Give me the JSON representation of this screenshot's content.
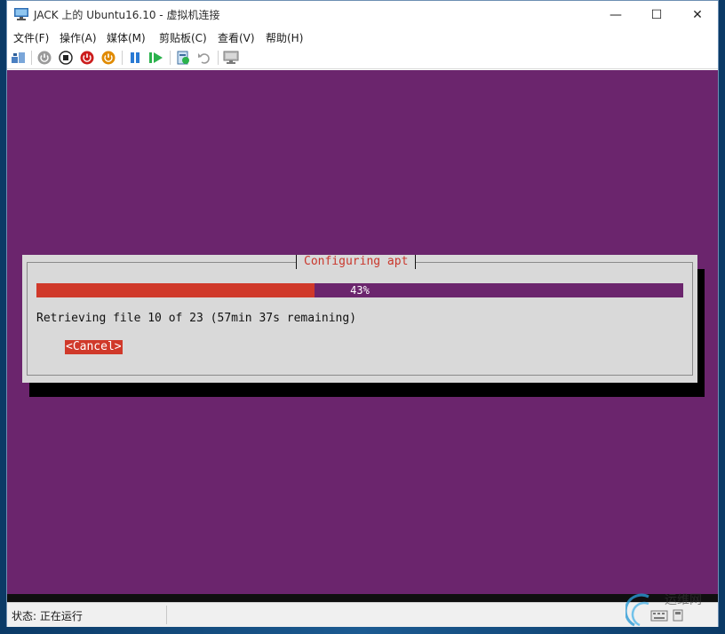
{
  "window": {
    "title": "JACK 上的 Ubuntu16.10 - 虚拟机连接",
    "min_glyph": "—",
    "max_glyph": "☐",
    "close_glyph": "✕"
  },
  "menu": {
    "items": [
      "文件(F)",
      "操作(A)",
      "媒体(M)",
      "剪贴板(C)",
      "查看(V)",
      "帮助(H)"
    ]
  },
  "toolbar": {
    "icons": [
      "ctrl-alt-del-icon",
      "start-icon",
      "turn-off-icon",
      "shut-down-icon",
      "save-icon",
      "pause-icon",
      "reset-icon",
      "checkpoint-icon",
      "revert-icon",
      "enhanced-session-icon"
    ]
  },
  "dialog": {
    "title": "Configuring apt",
    "progress_percent": 43,
    "progress_label": "43%",
    "status_line": "Retrieving file 10 of 23 (57min 37s remaining)",
    "cancel_label": "<Cancel>"
  },
  "statusbar": {
    "text": "状态: 正在运行"
  },
  "watermark": {
    "text": "运维网"
  },
  "colors": {
    "vm_background": "#6b256d",
    "accent": "#d0392a",
    "dialog_background": "#d9d9d9"
  }
}
